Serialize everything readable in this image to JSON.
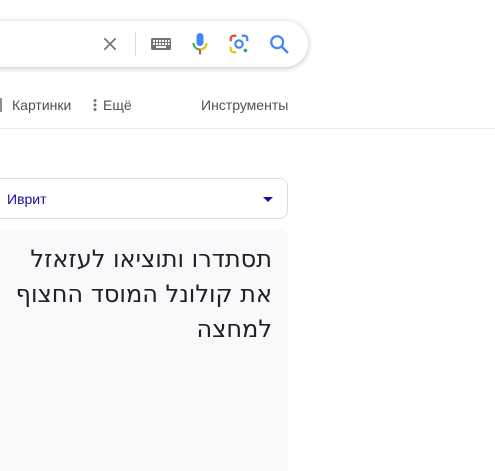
{
  "search": {
    "clear_icon": "close-icon",
    "keyboard_icon": "keyboard-icon",
    "mic_icon": "microphone-icon",
    "lens_icon": "google-lens-icon",
    "search_icon": "search-icon",
    "colors": {
      "blue": "#4285f4",
      "red": "#ea4335",
      "yellow": "#fbbc05",
      "green": "#34a853",
      "grey": "#70757a"
    }
  },
  "tabs": {
    "images_label": "Картинки",
    "more_label": "Ещё",
    "tools_label": "Инструменты"
  },
  "translator": {
    "target_language": "Иврит",
    "result_text": "תסתדרו ותוציאו לעזאזל את קולונל המוסד החצוף למחצה"
  }
}
